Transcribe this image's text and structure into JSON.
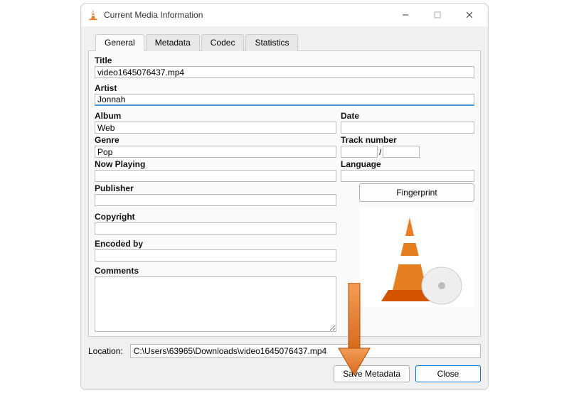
{
  "window": {
    "title": "Current Media Information"
  },
  "tabs": {
    "general": "General",
    "metadata": "Metadata",
    "codec": "Codec",
    "statistics": "Statistics"
  },
  "fields": {
    "title_label": "Title",
    "title_value": "video1645076437.mp4",
    "artist_label": "Artist",
    "artist_value": "Jonnah",
    "album_label": "Album",
    "album_value": "Web",
    "date_label": "Date",
    "date_value": "",
    "genre_label": "Genre",
    "genre_value": "Pop",
    "track_label": "Track number",
    "track_a": "",
    "track_sep": "/",
    "track_b": "",
    "nowplaying_label": "Now Playing",
    "nowplaying_value": "",
    "language_label": "Language",
    "language_value": "",
    "publisher_label": "Publisher",
    "publisher_value": "",
    "copyright_label": "Copyright",
    "copyright_value": "",
    "encodedby_label": "Encoded by",
    "encodedby_value": "",
    "comments_label": "Comments",
    "comments_value": ""
  },
  "buttons": {
    "fingerprint": "Fingerprint",
    "save_metadata": "Save Metadata",
    "close": "Close"
  },
  "location": {
    "label": "Location:",
    "value": "C:\\Users\\63965\\Downloads\\video1645076437.mp4"
  }
}
